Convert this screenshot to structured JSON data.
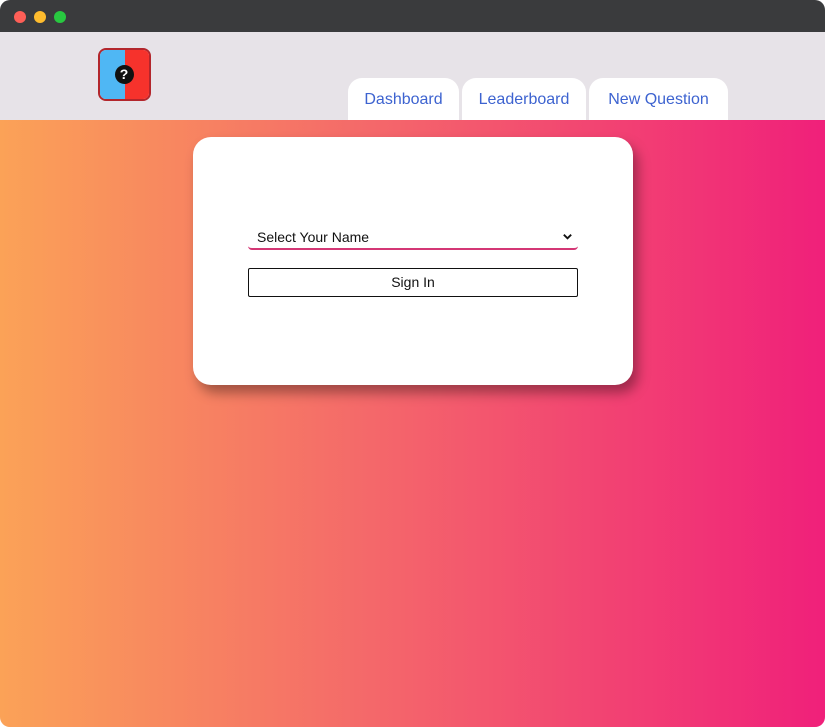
{
  "window": {
    "controls": [
      "close",
      "minimize",
      "maximize"
    ]
  },
  "header": {
    "logo_icon": "question-mark-icon",
    "logo_symbol": "?",
    "tabs": [
      {
        "label": "Dashboard"
      },
      {
        "label": "Leaderboard"
      },
      {
        "label": "New Question"
      }
    ]
  },
  "signin": {
    "select_value": "Select Your Name",
    "button_label": "Sign In"
  },
  "colors": {
    "gradient_start": "#fba257",
    "gradient_end": "#f0207a",
    "tab_text": "#3d63d0",
    "logo_left": "#4fb7f4",
    "logo_right": "#f6322c"
  }
}
